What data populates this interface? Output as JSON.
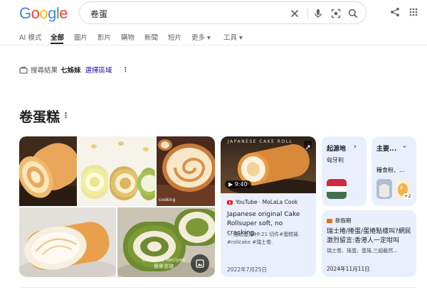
{
  "logo": "Google",
  "search": {
    "query": "卷蛋"
  },
  "tabs": [
    "AI 模式",
    "全部",
    "圖片",
    "影片",
    "購物",
    "新聞",
    "短片",
    "更多 ▾",
    "工具 ▾"
  ],
  "location": {
    "label": "搜尋結果",
    "place": "七姊妹",
    "link": "選擇區域"
  },
  "entity": {
    "title": "卷蛋糕"
  },
  "image_watermarks": {
    "img3": "cooking",
    "img5": "Christine Recipes\n簡單食譜"
  },
  "video": {
    "thumb_text": "JAPANESE CAKE ROLL",
    "duration": "9:40",
    "source": "YouTube · MoLaLa Cook",
    "title": "Japanese original Cake Rollsuper soft, no cracking...",
    "snippet": "... 捲起蛋捲07:21 切件#蛋糕捲 #rollcake #瑞士卷.",
    "date": "2022年7月25日"
  },
  "origin": {
    "label": "起源地",
    "value": "匈牙利"
  },
  "ingredients": {
    "label": "主要...",
    "value": "糧食粉、...",
    "extra": "+2"
  },
  "news": {
    "source": "新假期",
    "title": "瑞士捲/捲蛋/蛋捲點樣叫?網民激烈留言:香港人一定咁叫",
    "snippet": "瑞士卷、捲蛋、蛋捲,三組截然...",
    "date": "2024年11月11日"
  },
  "colors": {
    "accent": "#1a73e8",
    "card_bg": "#e9effc",
    "google_blue": "#4285f4",
    "google_red": "#ea4335",
    "google_yellow": "#fbbc05",
    "google_green": "#34a853"
  }
}
